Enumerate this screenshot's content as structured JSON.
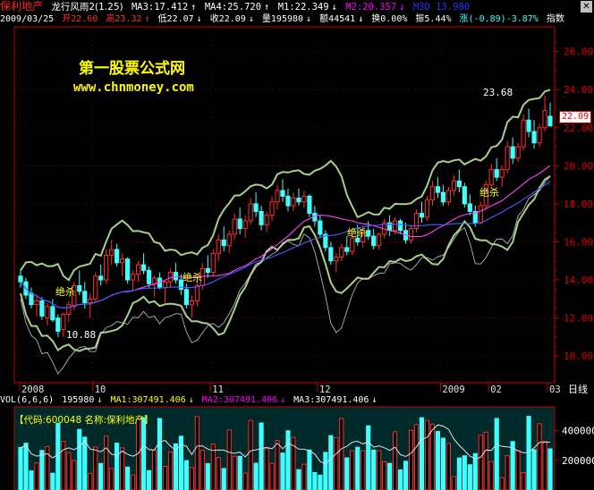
{
  "header": {
    "stock_name": "保利地产",
    "indicator": "龙行风雨2(1.25)",
    "ma3": "MA3:17.412",
    "ma4": "MA4:25.720",
    "m1": "M1:22.349",
    "m2": "M2:20.357",
    "m3": "M3D 13.980",
    "colors": {
      "name": "#ff2020",
      "indicator": "#ffffff",
      "ma3": "#ffffff",
      "ma4": "#ffffff",
      "m1": "#ffffff",
      "m2": "#ff00ff",
      "m3": "#3030ff"
    }
  },
  "quote": {
    "date": "2009/03/25",
    "open": "开22.60",
    "high": "高23.32",
    "low": "低22.07",
    "close": "收22.09",
    "volume": "量195980",
    "amount": "额44541",
    "turnover": "换0.00%",
    "amplitude": "振5.44%",
    "change": "涨(-0.89)-3.87%",
    "index_button": "指数"
  },
  "watermark": {
    "line1": "第一股票公式网",
    "line2": "www.chnmoney.com"
  },
  "price_labels": {
    "high": "23.68",
    "low": "10.88",
    "current": "22.09"
  },
  "signals": [
    "绝杀",
    "绝杀",
    "绝杀",
    "绝杀"
  ],
  "vol_header": {
    "vol": "VOL(6,6,6)",
    "value": "195980",
    "ma1": "MA1:307491.406",
    "ma2": "MA2:307491.406",
    "ma3": "MA3:307491.406"
  },
  "code_line": "【代码:600048 名称:保利地产】",
  "period_label": "日线",
  "colors": {
    "up": "#ff3030",
    "down": "#40ffff",
    "accent": "#ffff00",
    "grid": "#a00000",
    "axis": "#c00000"
  },
  "chart_data": [
    {
      "type": "candlestick",
      "x_ticks": [
        "2008",
        "10",
        "11",
        "12",
        "2009",
        "02",
        "03"
      ],
      "y_ticks": [
        10.0,
        12.0,
        14.0,
        16.0,
        18.0,
        20.0,
        22.0,
        24.0,
        26.0
      ],
      "ylim": [
        8.6,
        27.3
      ],
      "grid": true,
      "ohlc": [
        [
          14.2,
          14.5,
          13.6,
          13.9
        ],
        [
          13.9,
          14.1,
          13.0,
          13.2
        ],
        [
          13.3,
          13.6,
          12.5,
          12.7
        ],
        [
          12.7,
          13.2,
          12.1,
          12.9
        ],
        [
          12.9,
          13.1,
          11.9,
          12.1
        ],
        [
          12.0,
          12.8,
          11.6,
          12.6
        ],
        [
          12.6,
          13.0,
          11.8,
          11.9
        ],
        [
          12.0,
          12.2,
          11.0,
          11.3
        ],
        [
          11.4,
          12.3,
          11.0,
          12.2
        ],
        [
          12.2,
          12.9,
          11.8,
          12.7
        ],
        [
          12.6,
          13.9,
          12.4,
          13.7
        ],
        [
          13.7,
          14.5,
          13.2,
          13.4
        ],
        [
          13.4,
          13.9,
          12.5,
          12.8
        ],
        [
          12.8,
          13.3,
          12.0,
          13.0
        ],
        [
          13.0,
          14.4,
          12.8,
          14.2
        ],
        [
          14.2,
          14.8,
          13.7,
          14.0
        ],
        [
          14.0,
          15.6,
          13.8,
          15.3
        ],
        [
          15.3,
          16.1,
          14.8,
          15.6
        ],
        [
          15.6,
          15.9,
          14.7,
          14.9
        ],
        [
          14.9,
          15.4,
          14.2,
          15.1
        ],
        [
          15.1,
          15.2,
          13.8,
          14.0
        ],
        [
          14.0,
          14.5,
          13.4,
          14.3
        ],
        [
          14.3,
          15.0,
          13.9,
          14.8
        ],
        [
          14.8,
          15.4,
          14.3,
          14.5
        ],
        [
          14.5,
          14.7,
          13.6,
          13.8
        ],
        [
          13.8,
          14.2,
          13.1,
          14.1
        ],
        [
          14.1,
          14.4,
          13.5,
          13.6
        ],
        [
          13.6,
          14.0,
          12.8,
          13.9
        ],
        [
          13.9,
          14.6,
          13.6,
          14.4
        ],
        [
          14.4,
          14.9,
          13.8,
          14.0
        ],
        [
          14.0,
          14.3,
          13.2,
          13.5
        ],
        [
          13.5,
          13.8,
          12.5,
          12.7
        ],
        [
          12.7,
          13.2,
          12.0,
          12.9
        ],
        [
          12.9,
          13.9,
          12.6,
          13.7
        ],
        [
          13.7,
          14.9,
          13.5,
          14.6
        ],
        [
          14.6,
          15.3,
          14.1,
          14.4
        ],
        [
          14.4,
          15.6,
          14.2,
          15.4
        ],
        [
          15.4,
          16.4,
          15.0,
          16.1
        ],
        [
          16.1,
          16.8,
          15.5,
          15.8
        ],
        [
          15.8,
          16.6,
          15.4,
          16.4
        ],
        [
          16.4,
          17.5,
          16.1,
          17.2
        ],
        [
          17.2,
          17.8,
          16.4,
          16.7
        ],
        [
          16.7,
          17.4,
          16.2,
          17.1
        ],
        [
          17.1,
          18.3,
          16.9,
          18.0
        ],
        [
          18.0,
          18.6,
          17.3,
          17.6
        ],
        [
          17.6,
          17.9,
          16.6,
          16.9
        ],
        [
          16.9,
          17.6,
          16.5,
          17.4
        ],
        [
          17.4,
          18.4,
          17.1,
          18.1
        ],
        [
          18.1,
          19.0,
          17.7,
          18.7
        ],
        [
          18.7,
          19.3,
          18.1,
          18.4
        ],
        [
          18.4,
          18.8,
          17.6,
          17.9
        ],
        [
          17.9,
          18.6,
          17.6,
          18.3
        ],
        [
          18.3,
          18.8,
          17.9,
          18.1
        ],
        [
          18.1,
          18.7,
          17.8,
          18.4
        ],
        [
          18.4,
          18.5,
          17.3,
          17.5
        ],
        [
          17.5,
          17.9,
          16.8,
          17.1
        ],
        [
          17.1,
          17.4,
          16.2,
          16.4
        ],
        [
          16.4,
          16.6,
          15.5,
          15.7
        ],
        [
          15.7,
          16.0,
          14.8,
          15.0
        ],
        [
          15.0,
          15.4,
          14.4,
          15.2
        ],
        [
          15.2,
          15.9,
          15.0,
          15.7
        ],
        [
          15.7,
          16.3,
          15.3,
          15.5
        ],
        [
          15.5,
          16.4,
          15.3,
          16.2
        ],
        [
          16.2,
          16.9,
          15.8,
          16.0
        ],
        [
          16.0,
          16.8,
          15.7,
          16.6
        ],
        [
          16.6,
          17.1,
          16.1,
          16.3
        ],
        [
          16.3,
          16.7,
          15.6,
          15.8
        ],
        [
          15.8,
          16.5,
          15.6,
          16.4
        ],
        [
          16.4,
          17.2,
          16.2,
          17.0
        ],
        [
          17.0,
          17.4,
          16.3,
          16.6
        ],
        [
          16.6,
          17.3,
          16.4,
          17.1
        ],
        [
          17.1,
          17.2,
          16.4,
          16.6
        ],
        [
          16.6,
          17.0,
          15.9,
          16.1
        ],
        [
          16.1,
          16.9,
          15.9,
          16.7
        ],
        [
          16.7,
          17.7,
          16.5,
          17.5
        ],
        [
          17.5,
          18.1,
          17.0,
          17.3
        ],
        [
          17.3,
          18.4,
          17.1,
          18.2
        ],
        [
          18.2,
          19.2,
          17.9,
          18.9
        ],
        [
          18.9,
          19.4,
          18.3,
          18.6
        ],
        [
          18.6,
          19.0,
          17.9,
          18.1
        ],
        [
          18.1,
          18.9,
          17.9,
          18.7
        ],
        [
          18.7,
          19.5,
          18.4,
          19.2
        ],
        [
          19.2,
          19.8,
          18.6,
          18.9
        ],
        [
          18.9,
          19.1,
          17.8,
          18.0
        ],
        [
          18.0,
          18.5,
          17.4,
          17.6
        ],
        [
          17.6,
          17.9,
          16.8,
          17.0
        ],
        [
          17.0,
          18.1,
          16.9,
          17.9
        ],
        [
          17.9,
          19.2,
          17.7,
          19.0
        ],
        [
          19.0,
          20.1,
          18.8,
          19.8
        ],
        [
          19.8,
          20.4,
          19.2,
          19.4
        ],
        [
          19.4,
          20.0,
          18.9,
          19.8
        ],
        [
          19.8,
          21.3,
          19.6,
          21.0
        ],
        [
          21.0,
          21.5,
          20.1,
          20.4
        ],
        [
          20.4,
          21.2,
          20.2,
          21.0
        ],
        [
          21.0,
          22.7,
          20.8,
          22.4
        ],
        [
          22.4,
          23.0,
          21.5,
          21.8
        ],
        [
          21.8,
          22.4,
          20.9,
          21.2
        ],
        [
          21.2,
          22.2,
          21.0,
          22.0
        ],
        [
          22.0,
          23.68,
          21.8,
          22.9
        ],
        [
          22.6,
          23.32,
          22.07,
          22.09
        ]
      ]
    },
    {
      "type": "bar",
      "title": "VOL(6,6,6)",
      "y_ticks": [
        200000,
        400000
      ],
      "ylim": [
        0,
        560000
      ]
    }
  ]
}
